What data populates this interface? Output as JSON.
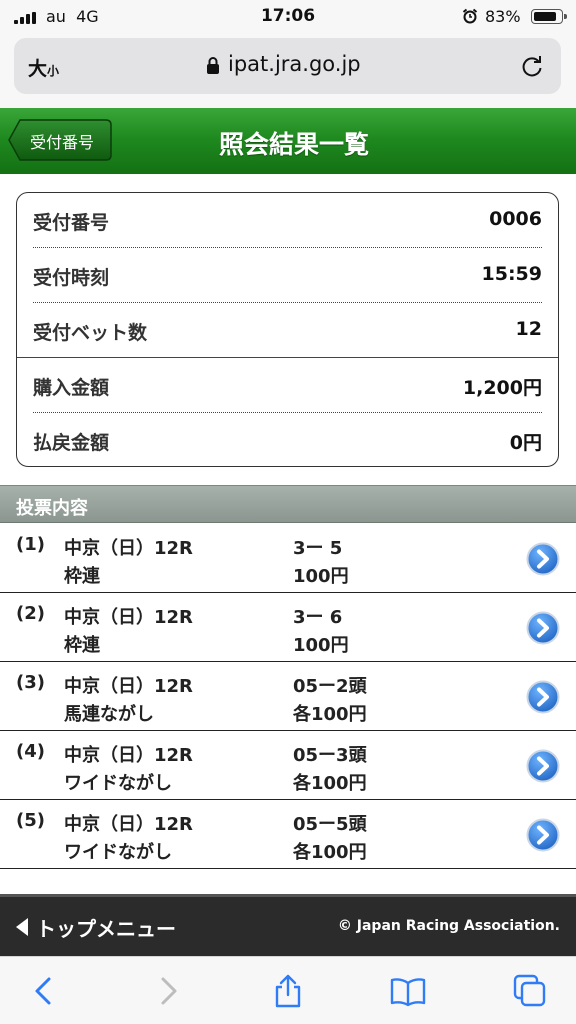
{
  "status_bar": {
    "carrier": "au",
    "network": "4G",
    "time": "17:06",
    "battery": "83%",
    "battery_level": 0.83
  },
  "browser": {
    "text_size_big": "大",
    "text_size_small": "小",
    "url": "ipat.jra.go.jp"
  },
  "header": {
    "back_label": "受付番号",
    "title": "照会結果一覧"
  },
  "summary": {
    "rows": [
      {
        "label": "受付番号",
        "value": "0006"
      },
      {
        "label": "受付時刻",
        "value": "15:59"
      },
      {
        "label": "受付ベット数",
        "value": "12"
      },
      {
        "label": "購入金額",
        "value": "1,200円"
      },
      {
        "label": "払戻金額",
        "value": "0円"
      }
    ]
  },
  "section": {
    "title": "投票内容"
  },
  "bets": [
    {
      "index": "(1)",
      "race": "中京（日）12R",
      "type": "枠連",
      "combo": "3ー 5",
      "amount": "100円"
    },
    {
      "index": "(2)",
      "race": "中京（日）12R",
      "type": "枠連",
      "combo": "3ー 6",
      "amount": "100円"
    },
    {
      "index": "(3)",
      "race": "中京（日）12R",
      "type": "馬連ながし",
      "combo": "05ー2頭",
      "amount": "各100円"
    },
    {
      "index": "(4)",
      "race": "中京（日）12R",
      "type": "ワイドながし",
      "combo": "05ー3頭",
      "amount": "各100円"
    },
    {
      "index": "(5)",
      "race": "中京（日）12R",
      "type": "ワイドながし",
      "combo": "05ー5頭",
      "amount": "各100円"
    }
  ],
  "footer": {
    "top_menu": "トップメニュー",
    "copyright": "© Japan Racing Association."
  },
  "colors": {
    "header_green": "#1f8a1f",
    "arrow_blue": "#1a6fd0",
    "footer_dark": "#2b2b2b",
    "ios_blue": "#2f7cf6"
  }
}
